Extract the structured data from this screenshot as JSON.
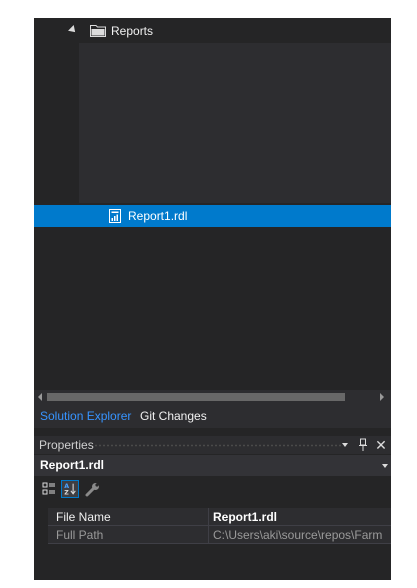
{
  "solution_explorer": {
    "tree": {
      "folder": {
        "label": "Reports",
        "expanded": true,
        "icon": "folder-icon"
      },
      "items": [
        {
          "label": "Report1.rdl",
          "selected": true,
          "icon": "report-file-icon"
        }
      ]
    },
    "tabs": [
      {
        "label": "Solution Explorer",
        "active": true
      },
      {
        "label": "Git Changes",
        "active": false
      }
    ]
  },
  "properties": {
    "title": "Properties",
    "selected_object": "Report1.rdl",
    "toolbar": {
      "categorized": "categorized-view-icon",
      "alphabetical": "alphabetical-sort-icon",
      "property_pages": "wrench-icon"
    },
    "rows": [
      {
        "name": "File Name",
        "value": "Report1.rdl"
      },
      {
        "name": "Full Path",
        "value": "C:\\Users\\aki\\source\\repos\\Farm"
      }
    ]
  },
  "colors": {
    "background": "#252526",
    "selection": "#007acc",
    "active_tab": "#3794ff"
  }
}
